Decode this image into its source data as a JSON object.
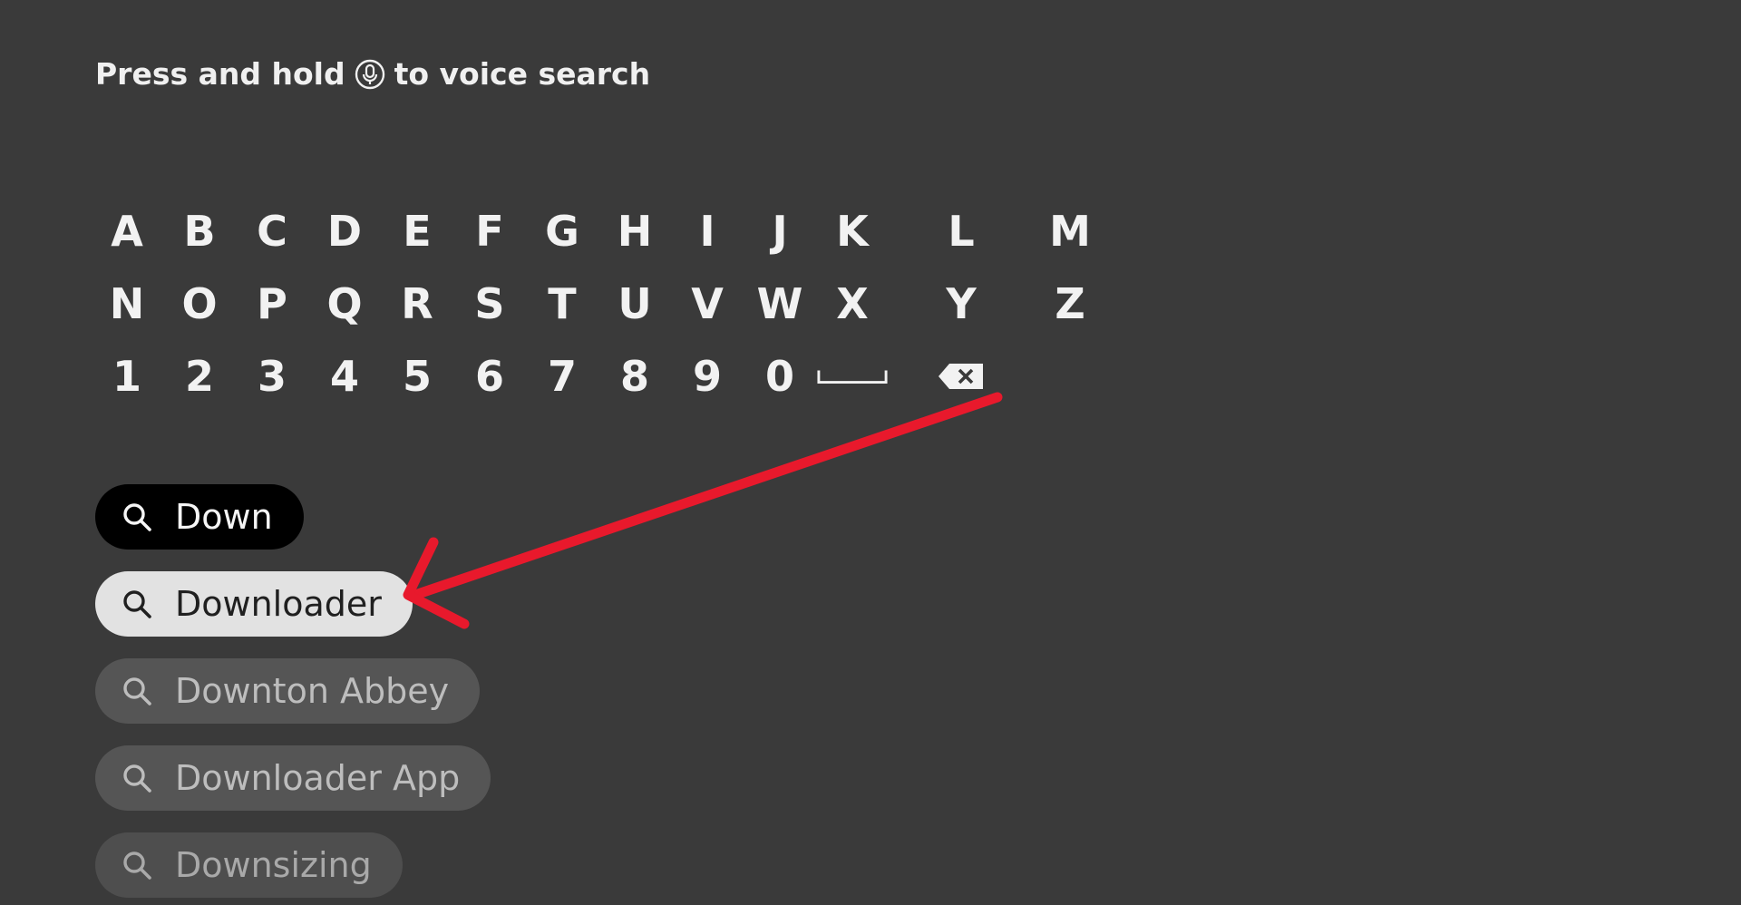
{
  "voice_hint": {
    "before": "Press and hold",
    "after": "to voice search",
    "icon": "microphone-icon"
  },
  "keyboard": {
    "row1": [
      "A",
      "B",
      "C",
      "D",
      "E",
      "F",
      "G",
      "H",
      "I",
      "J",
      "K",
      "L",
      "M"
    ],
    "row2": [
      "N",
      "O",
      "P",
      "Q",
      "R",
      "S",
      "T",
      "U",
      "V",
      "W",
      "X",
      "Y",
      "Z"
    ],
    "row3": [
      "1",
      "2",
      "3",
      "4",
      "5",
      "6",
      "7",
      "8",
      "9",
      "0"
    ],
    "space_icon": "space-bar-icon",
    "backspace_icon": "backspace-icon"
  },
  "suggestions": [
    {
      "label": "Down",
      "state": "typed"
    },
    {
      "label": "Downloader",
      "state": "focused"
    },
    {
      "label": "Downton Abbey",
      "state": "normal"
    },
    {
      "label": "Downloader App",
      "state": "normal"
    },
    {
      "label": "Downsizing",
      "state": "normal"
    }
  ],
  "colors": {
    "background": "#3a3a3a",
    "annotation_arrow": "#e8192c",
    "focused_pill": "#e2e2e2",
    "typed_pill": "#000000"
  }
}
